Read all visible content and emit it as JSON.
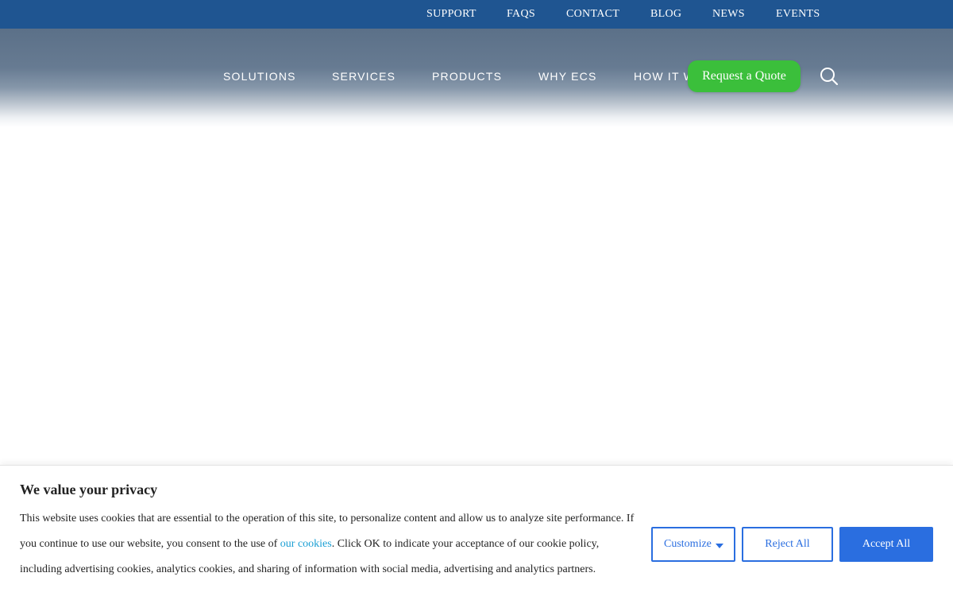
{
  "topbar": {
    "links": [
      "SUPPORT",
      "FAQS",
      "CONTACT",
      "BLOG",
      "NEWS",
      "EVENTS"
    ]
  },
  "mainnav": {
    "items": [
      "SOLUTIONS",
      "SERVICES",
      "PRODUCTS",
      "WHY ECS",
      "HOW IT W"
    ],
    "quote_label": "Request a Quote",
    "search_icon": "search-icon"
  },
  "cookie": {
    "title": "We value your privacy",
    "text_before": "This website uses cookies that are essential to the operation of this site, to personalize content and allow us to analyze site performance. If you continue to use our website, you consent to the use of ",
    "link_label": "our cookies",
    "text_after": ". Click OK to indicate your acceptance of our cookie policy, including advertising cookies, analytics cookies, and sharing of information with social media, advertising and analytics partners.",
    "customize_label": "Customize",
    "reject_label": "Reject All",
    "accept_label": "Accept All"
  },
  "colors": {
    "topbar_bg": "#1f5591",
    "quote_bg": "#3bbf3b",
    "primary": "#2a6ee0",
    "link": "#1a9fd4"
  }
}
